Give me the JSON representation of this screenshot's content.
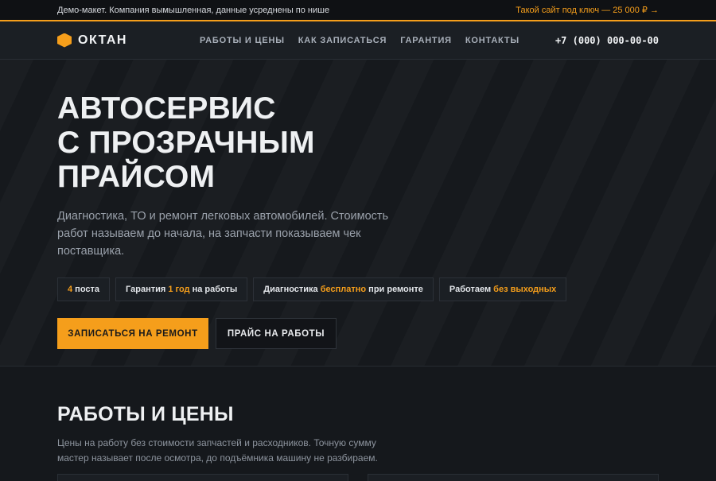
{
  "topbar": {
    "note": "Демо-макет. Компания вымышленная, данные усреднены по нише",
    "promo": "Такой сайт под ключ — 25 000 ₽ →"
  },
  "brand": {
    "name": "ОКТАН"
  },
  "nav": {
    "items": [
      "РАБОТЫ И ЦЕНЫ",
      "КАК ЗАПИСАТЬСЯ",
      "ГАРАНТИЯ",
      "КОНТАКТЫ"
    ],
    "phone": "+7 (000) 000-00-00"
  },
  "hero": {
    "title_lines": [
      "АВТОСЕРВИС",
      "С ПРОЗРАЧНЫМ",
      "ПРАЙСОМ"
    ],
    "lead": "Диагностика, ТО и ремонт легковых автомобилей. Стоимость работ называем до начала, на запчасти показываем чек поставщика.",
    "badges": [
      {
        "pre": "",
        "accent": "4",
        "post": " поста"
      },
      {
        "pre": "Гарантия ",
        "accent": "1 год",
        "post": " на работы"
      },
      {
        "pre": "Диагностика ",
        "accent": "бесплатно",
        "post": " при ремонте"
      },
      {
        "pre": "Работаем ",
        "accent": "без выходных",
        "post": ""
      }
    ],
    "cta_primary": "ЗАПИСАТЬСЯ НА РЕМОНТ",
    "cta_secondary": "ПРАЙС НА РАБОТЫ"
  },
  "section": {
    "title": "РАБОТЫ И ЦЕНЫ",
    "desc": "Цены на работу без стоимости запчастей и расходников. Точную сумму мастер называет после осмотра, до подъёмника машину не разбираем."
  },
  "colors": {
    "accent": "#f59e1b",
    "background": "#15181c"
  }
}
